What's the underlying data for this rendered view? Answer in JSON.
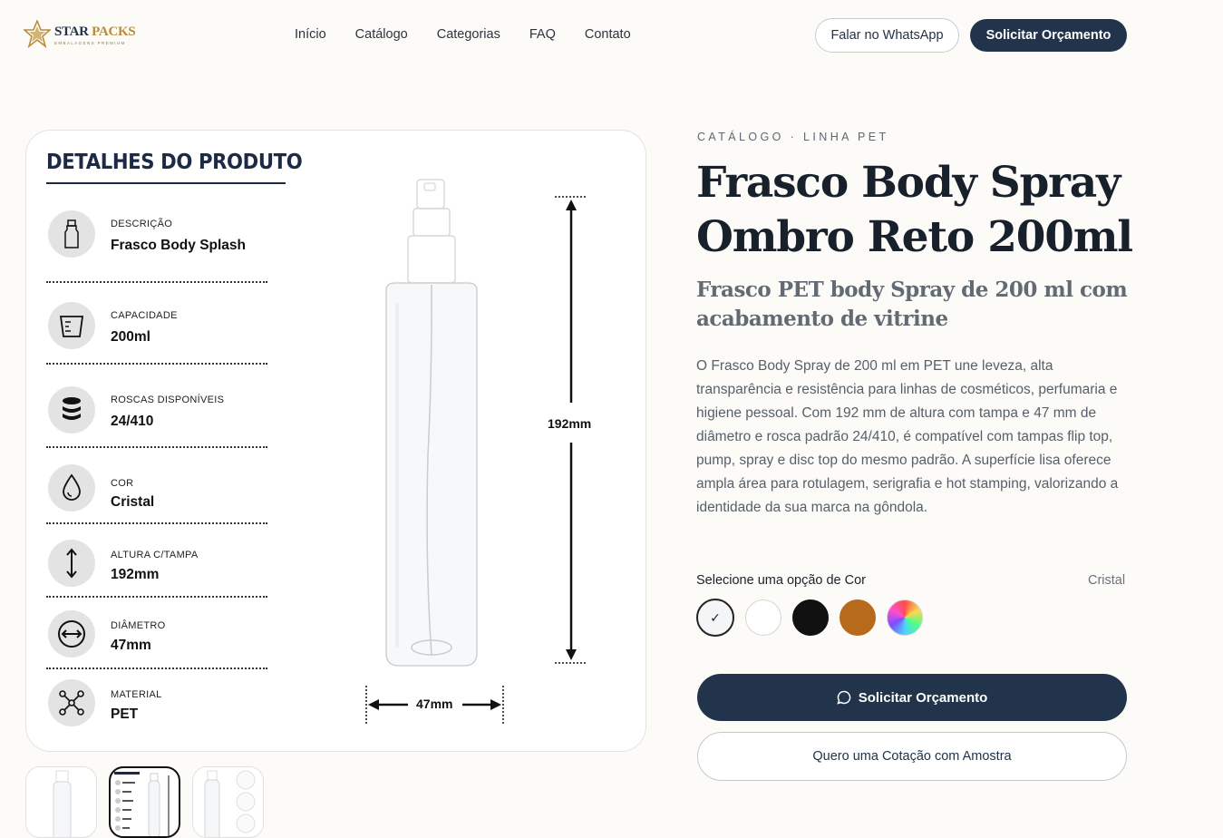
{
  "header": {
    "logo_main": "STAR",
    "logo_main_accent": "PACKS",
    "logo_sub": "EMBALAGENS PREMIUM",
    "nav": [
      "Início",
      "Catálogo",
      "Categorias",
      "FAQ",
      "Contato"
    ],
    "whatsapp_label": "Falar no WhatsApp",
    "quote_label": "Solicitar Orçamento"
  },
  "product_image": {
    "title": "DETALHES DO PRODUTO",
    "specs": [
      {
        "label": "DESCRIÇÃO",
        "value": "Frasco Body Splash",
        "icon": "bottle-icon"
      },
      {
        "label": "CAPACIDADE",
        "value": "200ml",
        "icon": "measuring-cup-icon"
      },
      {
        "label": "ROSCAS DISPONÍVEIS",
        "value": "24/410",
        "icon": "thread-coins-icon"
      },
      {
        "label": "COR",
        "value": "Cristal",
        "icon": "drop-icon"
      },
      {
        "label": "ALTURA C/TAMPA",
        "value": "192mm",
        "icon": "height-arrow-icon"
      },
      {
        "label": "DIÂMETRO",
        "value": "47mm",
        "icon": "diameter-arrow-icon"
      },
      {
        "label": "MATERIAL",
        "value": "PET",
        "icon": "molecule-icon"
      }
    ],
    "height_dim": "192mm",
    "width_dim": "47mm"
  },
  "product": {
    "eyebrow": "CATÁLOGO · LINHA PET",
    "title": "Frasco Body Spray Ombro Reto 200ml",
    "subtitle": "Frasco PET body Spray de 200 ml com acabamento de vitrine",
    "description": "O Frasco Body Spray de 200 ml em PET une leveza, alta transparência e resistência para linhas de cosméticos, perfumaria e higiene pessoal. Com 192 mm de altura com tampa e 47 mm de diâmetro e rosca padrão 24/410, é compatível com tampas flip top, pump, spray e disc top do mesmo padrão. A superfície lisa oferece ampla área para rotulagem, serigrafia e hot stamping, valorizando a identidade da sua marca na gôndola.",
    "option_label": "Selecione uma opção de Cor",
    "option_value": "Cristal",
    "colors": [
      {
        "name": "Cristal",
        "hex": "#f4f5f7",
        "selected": true
      },
      {
        "name": "Branco",
        "hex": "#ffffff"
      },
      {
        "name": "Preto",
        "hex": "#111111"
      },
      {
        "name": "Âmbar",
        "hex": "#b86a1c"
      },
      {
        "name": "Colorido",
        "hex": "multicolor"
      }
    ],
    "check_mark": "✓",
    "primary_cta": "Solicitar Orçamento",
    "secondary_cta": "Quero uma Cotação com Amostra"
  }
}
